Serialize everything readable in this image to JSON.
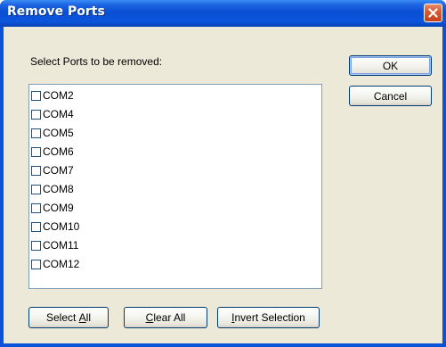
{
  "window": {
    "title": "Remove Ports",
    "close_icon": "close-icon"
  },
  "dialog": {
    "prompt": "Select Ports to be removed:",
    "ports": [
      {
        "name": "COM2",
        "checked": false
      },
      {
        "name": "COM4",
        "checked": false
      },
      {
        "name": "COM5",
        "checked": false
      },
      {
        "name": "COM6",
        "checked": false
      },
      {
        "name": "COM7",
        "checked": false
      },
      {
        "name": "COM8",
        "checked": false
      },
      {
        "name": "COM9",
        "checked": false
      },
      {
        "name": "COM10",
        "checked": false
      },
      {
        "name": "COM11",
        "checked": false
      },
      {
        "name": "COM12",
        "checked": false
      }
    ],
    "buttons": {
      "ok": "OK",
      "cancel": "Cancel",
      "select_all": {
        "before": "Select ",
        "mnemonic": "A",
        "after": "ll"
      },
      "clear_all": {
        "before": "",
        "mnemonic": "C",
        "after": "lear All"
      },
      "invert_selection": {
        "before": "",
        "mnemonic": "I",
        "after": "nvert Selection"
      }
    }
  },
  "colors": {
    "titlebar": "#0a4fd4",
    "dialog_face": "#ece9d8",
    "button_border": "#003c74",
    "close_button": "#d8582f"
  }
}
